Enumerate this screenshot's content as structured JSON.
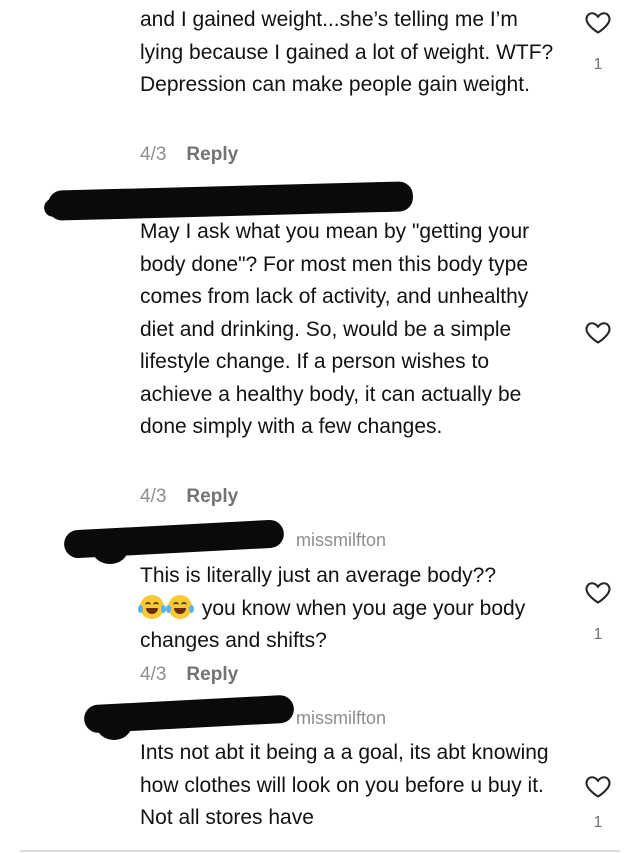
{
  "comments": [
    {
      "text": "and I gained weight...she’s telling me I’m lying because I gained a lot of weight. WTF? Depression can make people gain weight.",
      "date": "4/3",
      "reply_label": "Reply",
      "likes": "1"
    },
    {
      "username": "",
      "text": "May I ask what you mean by \"getting your body done\"? For most men this body type comes from lack of activity, and unhealthy diet and drinking. So, would be a simple lifestyle change. If a person wishes to achieve a healthy body, it can actually be done simply with a few changes.",
      "date": "4/3",
      "reply_label": "Reply",
      "likes": ""
    },
    {
      "reply_to": "missmilfton",
      "text_line1": "This is literally just an average body??",
      "text_after_emoji": "you know when you age your body changes and shifts?",
      "date": "4/3",
      "reply_label": "Reply",
      "likes": "1"
    },
    {
      "reply_to": "missmilfton",
      "text": "Ints not abt it being a a goal, its abt knowing how clothes will look on you before u buy it. Not all stores have",
      "likes": "1"
    }
  ],
  "icons": {
    "like": "heart-outline-icon",
    "emoji": "face-with-tears-of-joy-icon"
  },
  "colors": {
    "text": "#121212",
    "meta": "#8e8e8e",
    "redaction": "#0a0a0a"
  }
}
